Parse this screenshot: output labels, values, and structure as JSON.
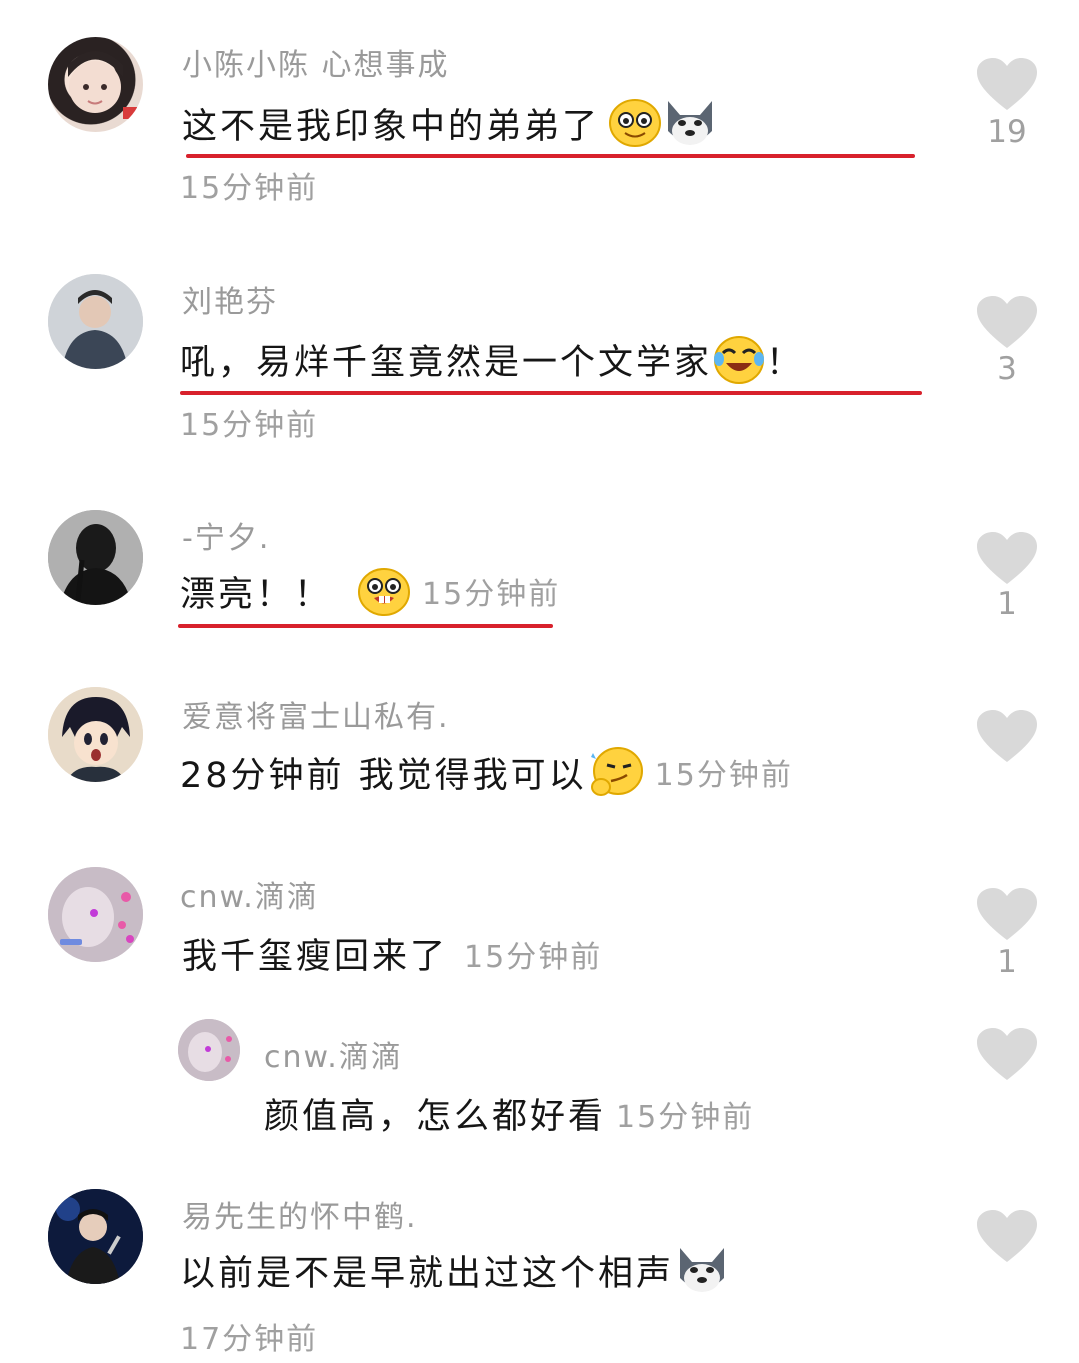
{
  "comments": [
    {
      "username": "小陈小陈 心想事成",
      "text": "这不是我印象中的弟弟了",
      "emojis": [
        "grin-emoji",
        "husky-dog-emoji"
      ],
      "time": "15分钟前",
      "likes": "19",
      "highlighted": true
    },
    {
      "username": "刘艳芬",
      "text": "吼，易烊千玺竟然是一个文学家",
      "text_suffix": "！",
      "emojis": [
        "laugh-cry-emoji"
      ],
      "time": "15分钟前",
      "likes": "3",
      "highlighted": true
    },
    {
      "username": "-宁夕.",
      "text": "漂亮！！",
      "emojis": [
        "buck-teeth-emoji"
      ],
      "time": "15分钟前",
      "likes": "1",
      "highlighted": true
    },
    {
      "username": "爱意将富士山私有.",
      "text": "28分钟前 我觉得我可以",
      "emojis": [
        "smirk-thinking-emoji"
      ],
      "time": "15分钟前",
      "likes": ""
    },
    {
      "username": "cnw.滴滴",
      "text": "我千玺瘦回来了",
      "time": "15分钟前",
      "likes": "1"
    },
    {
      "username": "cnw.滴滴",
      "text": "颜值高，怎么都好看",
      "time": "15分钟前",
      "likes": "",
      "reply": true
    },
    {
      "username": "易先生的怀中鹤.",
      "text": "以前是不是早就出过这个相声",
      "emojis": [
        "husky-dog-emoji"
      ],
      "time": "17分钟前",
      "likes": ""
    }
  ],
  "colors": {
    "underline": "#d8212c",
    "heart": "#d9d9d9",
    "meta_text": "#9a9a9a"
  }
}
